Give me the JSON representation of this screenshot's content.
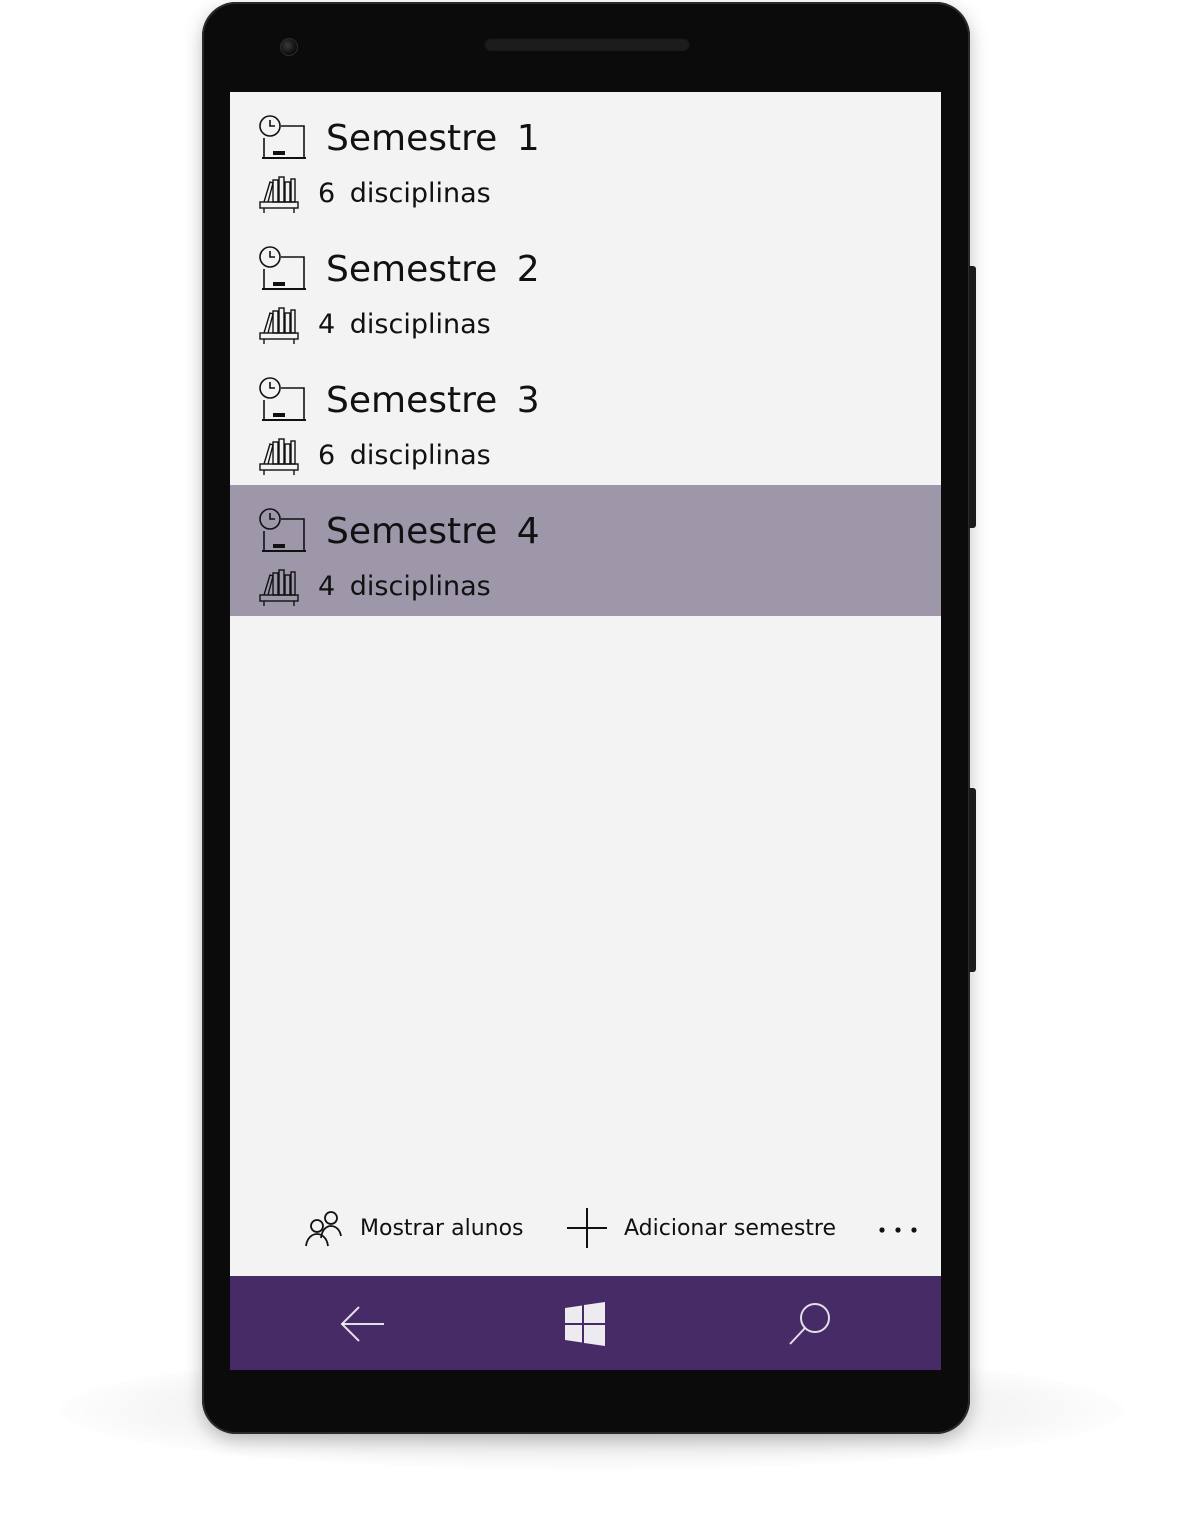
{
  "semesters": [
    {
      "title": "Semestre  1",
      "count": "6  disciplinas",
      "selected": false
    },
    {
      "title": "Semestre  2",
      "count": "4  disciplinas",
      "selected": false
    },
    {
      "title": "Semestre  3",
      "count": "6  disciplinas",
      "selected": false
    },
    {
      "title": "Semestre  4",
      "count": "4  disciplinas",
      "selected": true
    }
  ],
  "appbar": {
    "show_students_label": "Mostrar alunos",
    "add_semester_label": "Adicionar semestre",
    "more_label": "..."
  },
  "colors": {
    "accent": "#462b66",
    "selected_row": "#9e97aa",
    "background": "#f3f3f3"
  },
  "icons": {
    "semester": "clock-board-icon",
    "subjects": "bookshelf-icon",
    "students": "people-icon",
    "add": "plus-icon",
    "more": "ellipsis-icon",
    "back": "back-arrow-icon",
    "start": "windows-logo-icon",
    "search": "search-icon"
  }
}
